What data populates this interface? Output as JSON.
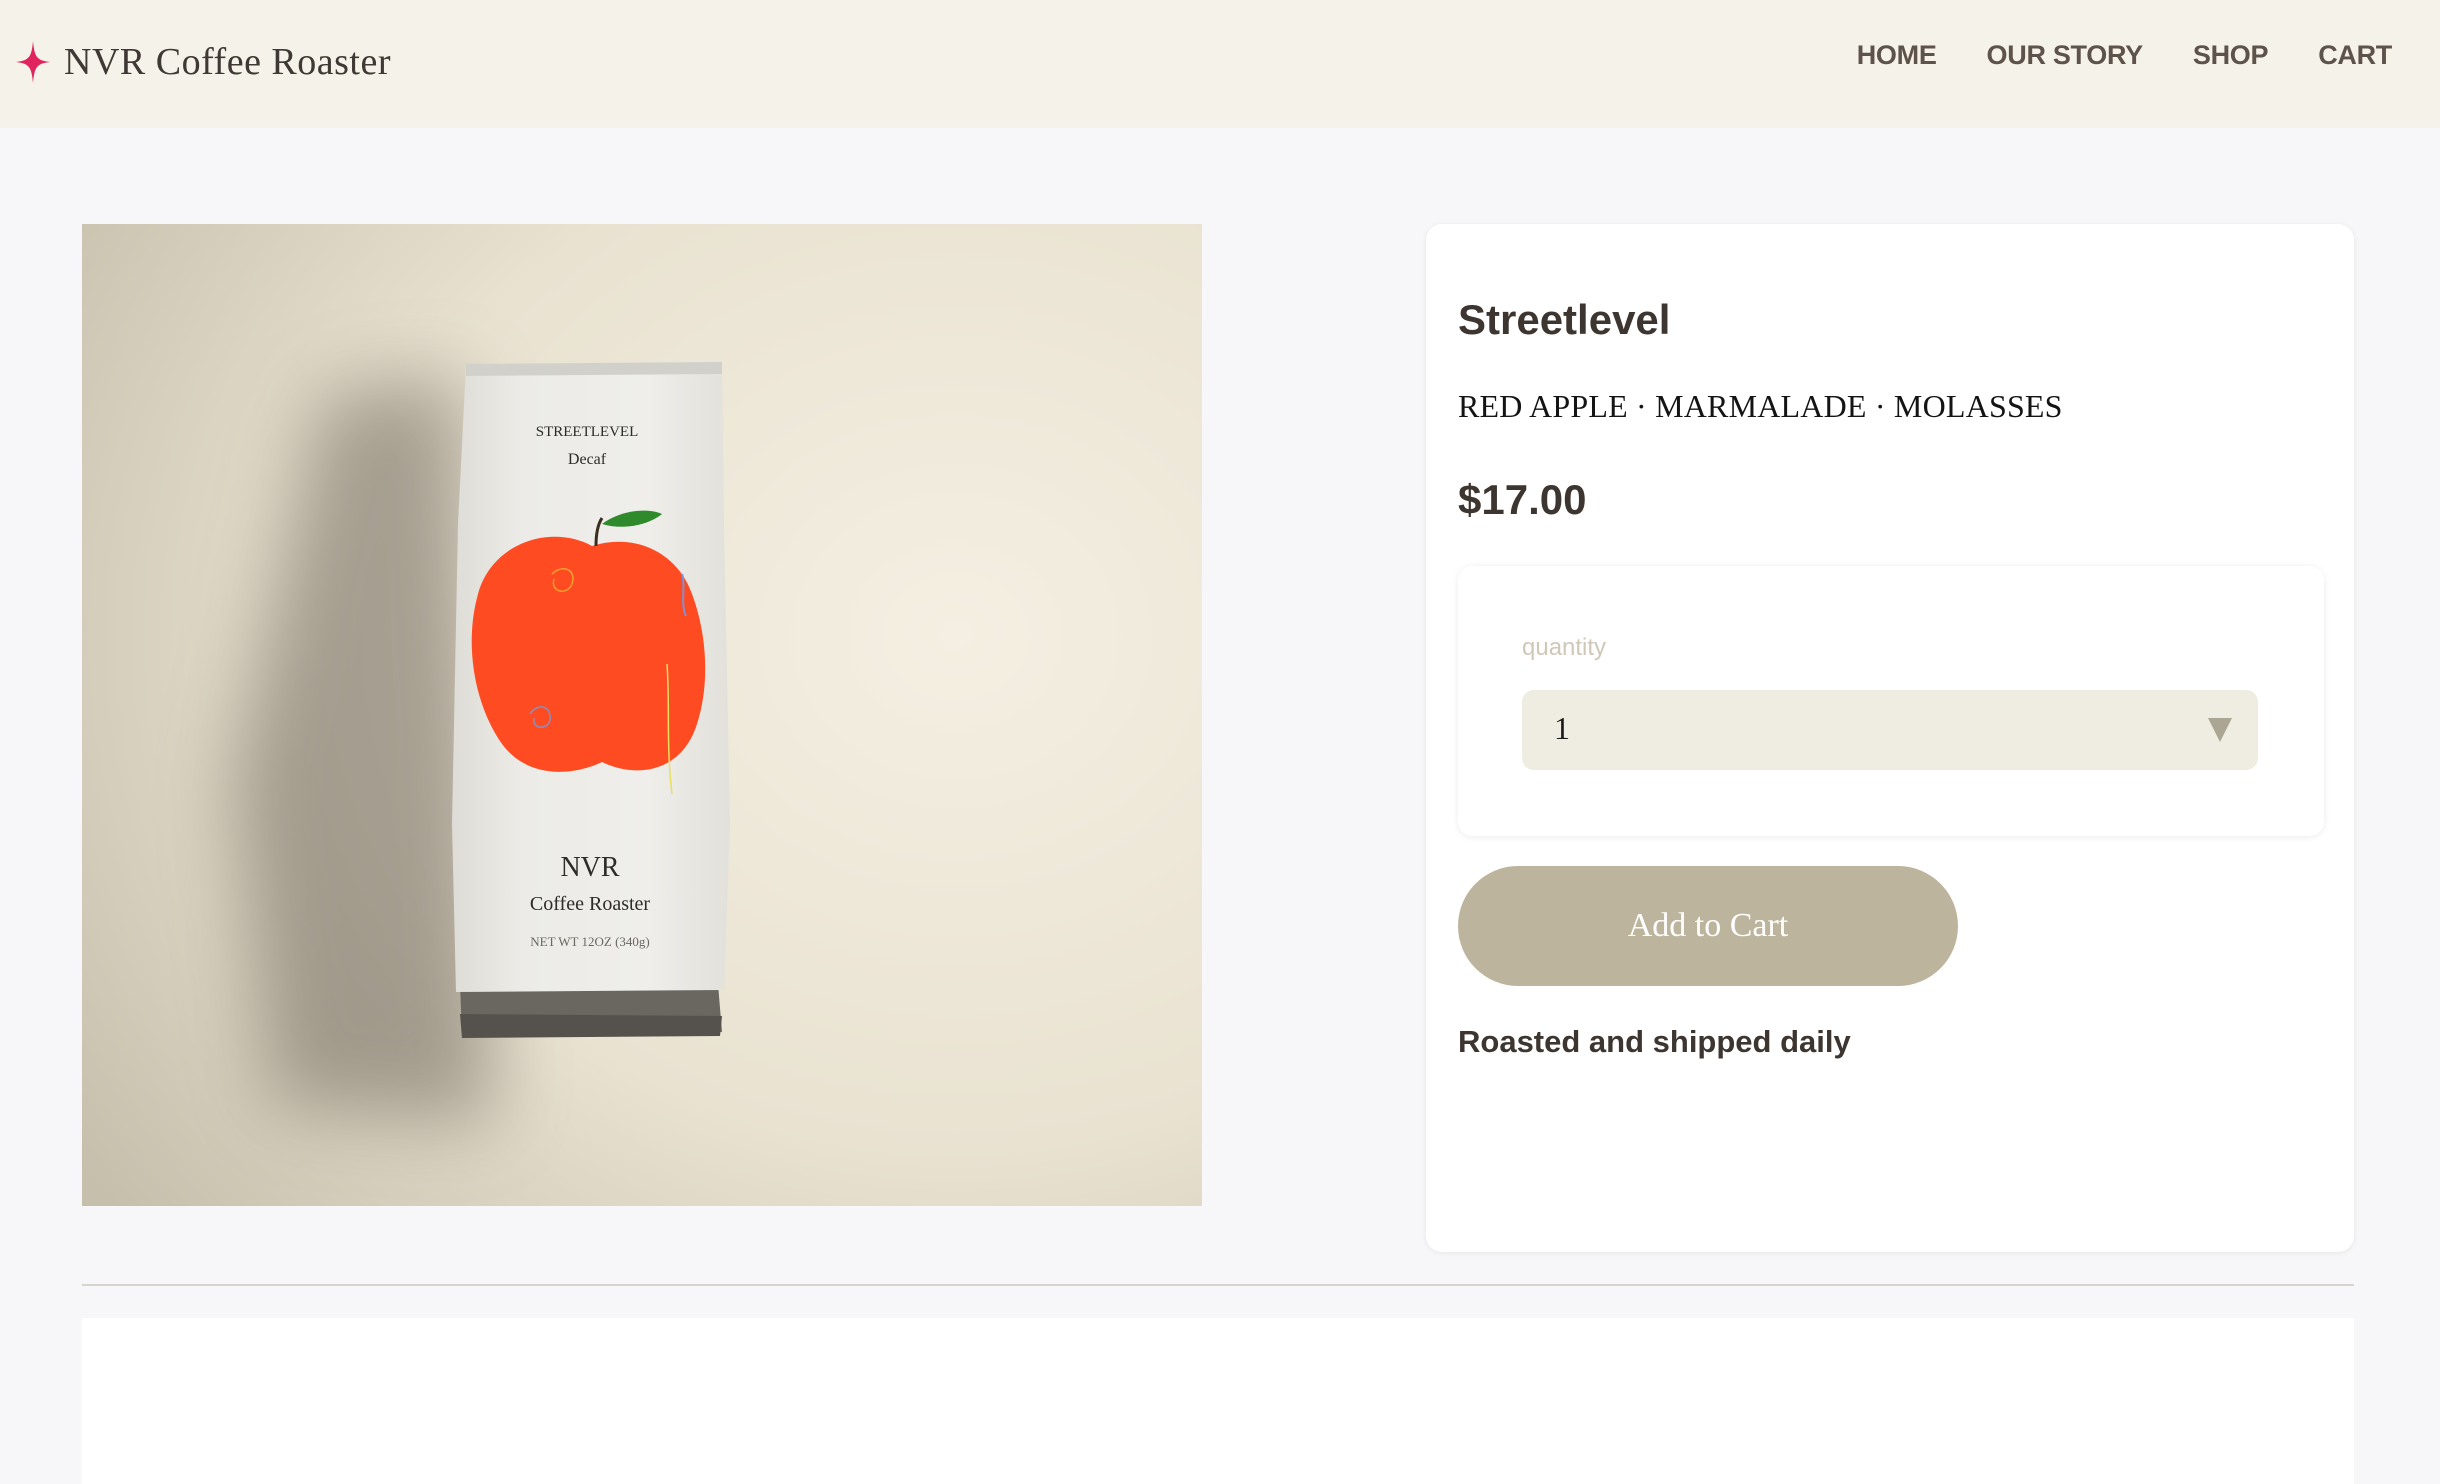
{
  "header": {
    "brand": "NVR Coffee Roaster",
    "logo_icon": "four-point-star-icon",
    "logo_color": "#e0245e",
    "background": "#f5f2ea",
    "nav": [
      {
        "label": "HOME"
      },
      {
        "label": "OUR STORY"
      },
      {
        "label": "SHOP"
      },
      {
        "label": "CART"
      }
    ]
  },
  "product": {
    "image": {
      "bag_label_line1": "STREETLEVEL",
      "bag_label_line2": "Decaf",
      "bag_brand_line1": "NVR",
      "bag_brand_line2": "Coffee Roaster",
      "bag_weight": "NET WT 12OZ (340g)",
      "apple_color": "#ff4b22"
    },
    "title": "Streetlevel",
    "tasting_notes": "RED APPLE · MARMALADE · MOLASSES",
    "price": "$17.00",
    "quantity": {
      "label": "quantity",
      "selected": "1",
      "icon": "triangle-down-icon"
    },
    "add_to_cart_label": "Add to Cart",
    "add_to_cart_color": "#bcb49c",
    "shipping_note": "Roasted and shipped daily"
  }
}
